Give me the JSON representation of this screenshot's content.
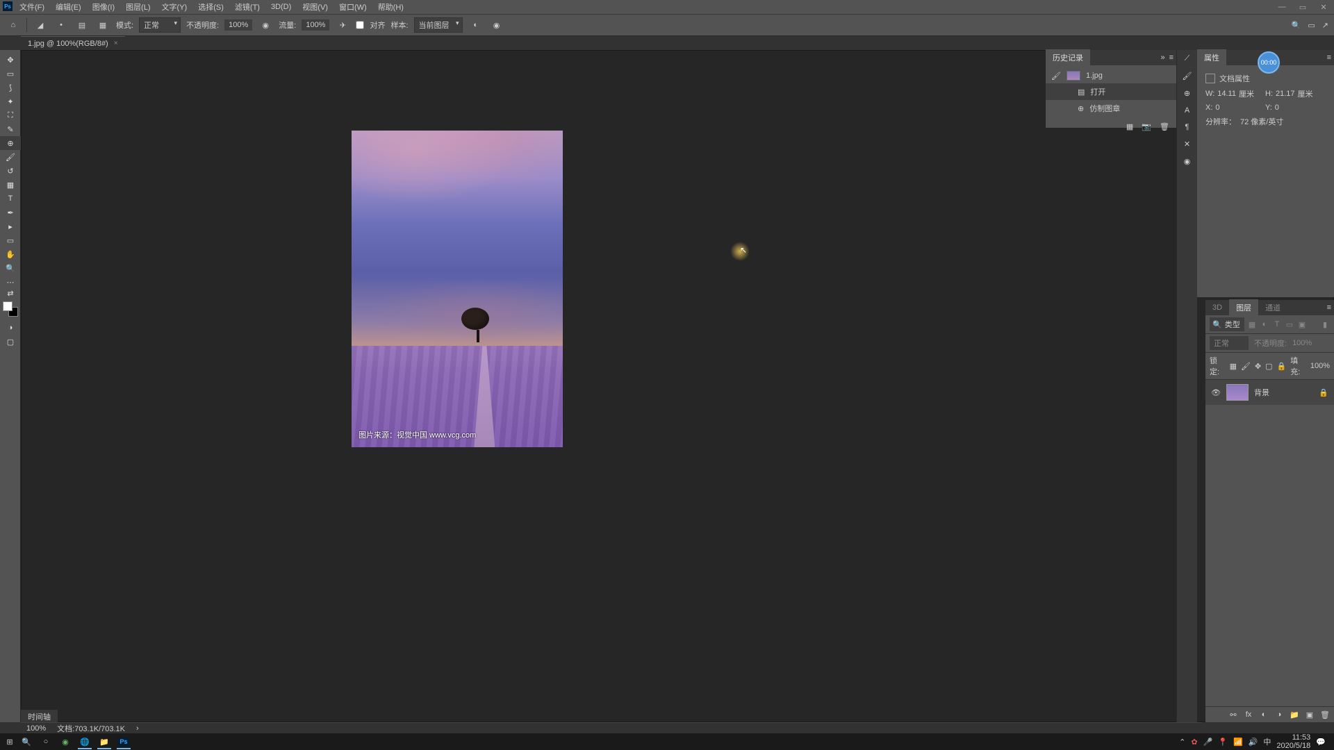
{
  "menubar": {
    "items": [
      "文件(F)",
      "编辑(E)",
      "图像(I)",
      "图层(L)",
      "文字(Y)",
      "选择(S)",
      "滤镜(T)",
      "3D(D)",
      "视图(V)",
      "窗口(W)",
      "帮助(H)"
    ]
  },
  "optionsbar": {
    "mode_label": "模式:",
    "mode_value": "正常",
    "opacity_label": "不透明度:",
    "opacity_value": "100%",
    "flow_label": "流量:",
    "flow_value": "100%",
    "align_label": "对齐",
    "sample_label": "样本:",
    "sample_value": "当前图层"
  },
  "document": {
    "tab_title": "1.jpg @ 100%(RGB/8#)",
    "watermark": "图片来源：视觉中国 www.vcg.com"
  },
  "history": {
    "title": "历史记录",
    "file": "1.jpg",
    "items": [
      "打开",
      "仿制图章"
    ]
  },
  "properties": {
    "title": "属性",
    "doc_props": "文档属性",
    "w_label": "W:",
    "w_value": "14.11",
    "w_unit": "厘米",
    "h_label": "H:",
    "h_value": "21.17",
    "h_unit": "厘米",
    "x_label": "X:",
    "x_value": "0",
    "y_label": "Y:",
    "y_value": "0",
    "res_label": "分辨率：",
    "res_value": "72 像素/英寸"
  },
  "timer": "00:00",
  "layers": {
    "tabs": [
      "3D",
      "图层",
      "通道"
    ],
    "filter_placeholder": "类型",
    "blend_mode": "正常",
    "opacity_label": "不透明度:",
    "opacity_value": "100%",
    "lock_label": "锁定:",
    "fill_label": "填充:",
    "fill_value": "100%",
    "layer_name": "背景"
  },
  "status": {
    "zoom": "100%",
    "doc_info": "文档:703.1K/703.1K",
    "timeline": "时间轴"
  },
  "taskbar": {
    "time": "11:53",
    "date": "2020/5/18"
  }
}
